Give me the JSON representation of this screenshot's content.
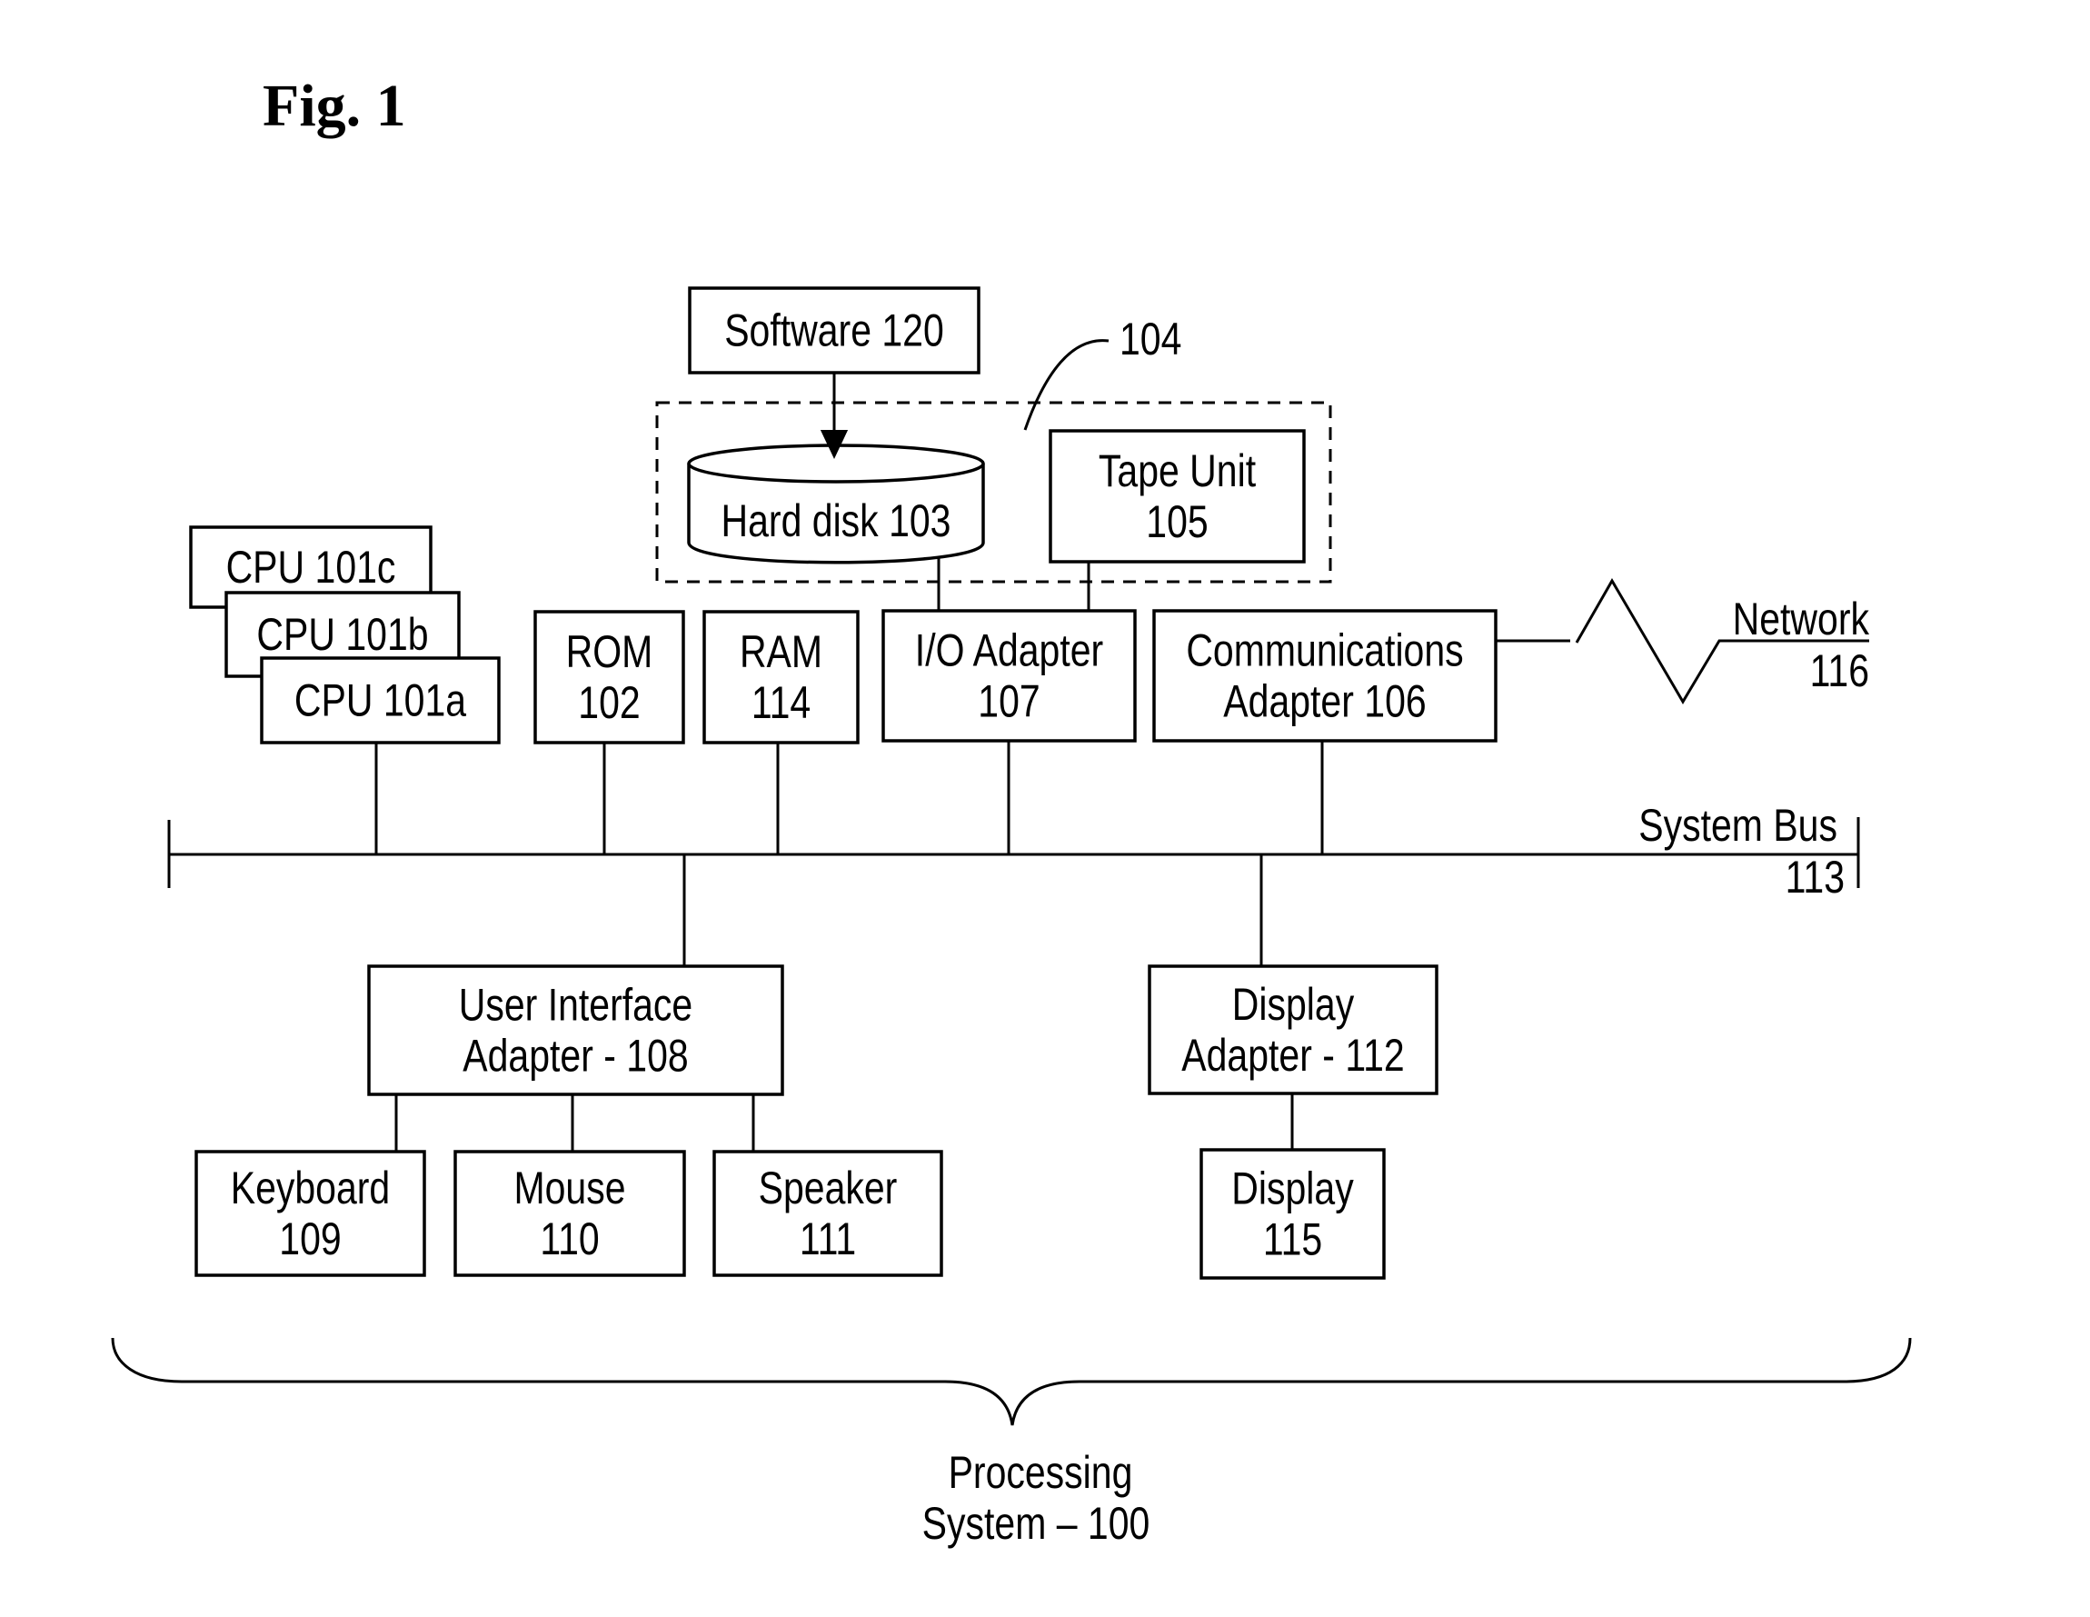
{
  "figure": {
    "title": "Fig. 1",
    "system_bus": {
      "name": "System Bus",
      "ref": "113"
    },
    "network": {
      "name": "Network",
      "ref": "116"
    },
    "storage_group_ref": "104",
    "components": {
      "software": {
        "lines": [
          "Software 120"
        ]
      },
      "hard_disk": {
        "lines": [
          "Hard disk 103"
        ]
      },
      "tape_unit": {
        "lines": [
          "Tape Unit",
          "105"
        ]
      },
      "cpu_c": {
        "lines": [
          "CPU 101c"
        ]
      },
      "cpu_b": {
        "lines": [
          "CPU 101b"
        ]
      },
      "cpu_a": {
        "lines": [
          "CPU 101a"
        ]
      },
      "rom": {
        "lines": [
          "ROM",
          "102"
        ]
      },
      "ram": {
        "lines": [
          "RAM",
          "114"
        ]
      },
      "io_adapter": {
        "lines": [
          "I/O Adapter",
          "107"
        ]
      },
      "comm_adapter": {
        "lines": [
          "Communications",
          "Adapter 106"
        ]
      },
      "ui_adapter": {
        "lines": [
          "User Interface",
          "Adapter - 108"
        ]
      },
      "display_adapter": {
        "lines": [
          "Display",
          "Adapter - 112"
        ]
      },
      "keyboard": {
        "lines": [
          "Keyboard",
          "109"
        ]
      },
      "mouse": {
        "lines": [
          "Mouse",
          "110"
        ]
      },
      "speaker": {
        "lines": [
          "Speaker",
          "111"
        ]
      },
      "display": {
        "lines": [
          "Display",
          "115"
        ]
      }
    },
    "caption": {
      "lines": [
        "Processing",
        "System – 100"
      ]
    }
  }
}
